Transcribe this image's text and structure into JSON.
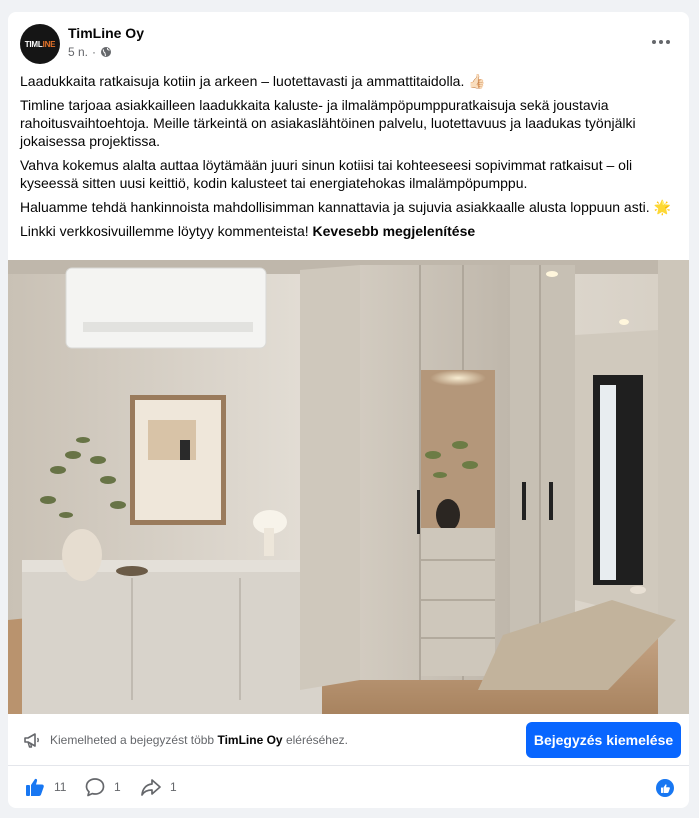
{
  "post": {
    "author": "TimLine Oy",
    "time": "5 n.",
    "separator": "·",
    "avatar_text_a": "TIML",
    "avatar_text_b": "INE",
    "paragraphs": [
      "Laadukkaita ratkaisuja kotiin ja arkeen – luotettavasti ja ammattitaidolla. 👍🏻",
      "Timline tarjoaa asiakkailleen laadukkaita kaluste- ja ilmalämpöpumppuratkaisuja sekä joustavia rahoitusvaihtoehtoja. Meille tärkeintä on asiakaslähtöinen palvelu, luotettavuus ja laadukas työnjälki jokaisessa projektissa.",
      "Vahva kokemus alalta auttaa löytämään juuri sinun kotiisi tai kohteeseesi sopivimmat ratkaisut – oli kyseessä sitten uusi keittiö, kodin kalusteet tai energiatehokas ilmalämpöpumppu.",
      "Haluamme tehdä hankinnoista mahdollisimman kannattavia ja sujuvia asiakkaalle alusta loppuun asti. 🌟"
    ],
    "last_line": "Linkki verkkosivuillemme löytyy kommenteista!",
    "see_more": "Kevesebb megjelenítése"
  },
  "promo": {
    "text_before": "Kiemelheted a bejegyzést több",
    "page_name": "TimLine Oy",
    "text_after": "eléréséhez.",
    "button": "Bejegyzés kiemelése"
  },
  "stats": {
    "likes": "11",
    "comments": "1",
    "shares": "1"
  },
  "colors": {
    "accent": "#0866ff",
    "like_blue": "#1877f2",
    "secondary_text": "#65676b"
  }
}
